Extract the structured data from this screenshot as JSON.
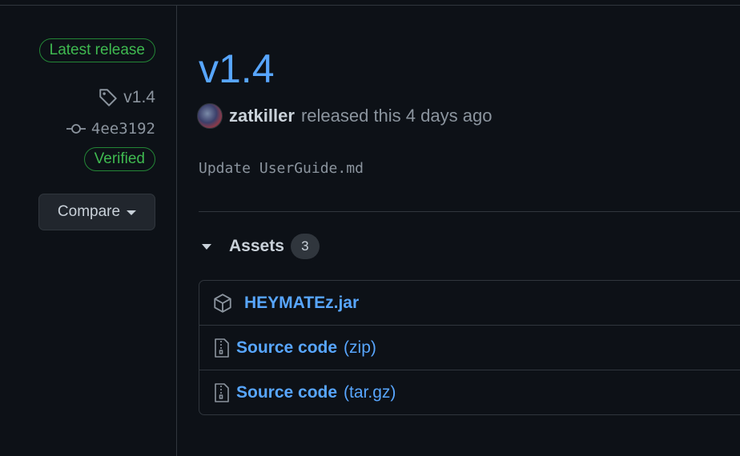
{
  "sidebar": {
    "latest_badge": "Latest release",
    "tag": "v1.4",
    "commit": "4ee3192",
    "verified_badge": "Verified",
    "compare_label": "Compare"
  },
  "release": {
    "title": "v1.4",
    "author": "zatkiller",
    "released_text": "released this 4 days ago",
    "body": "Update UserGuide.md"
  },
  "assets": {
    "label": "Assets",
    "count": "3",
    "items": [
      {
        "name": "HEYMATEz.jar",
        "suffix": "",
        "icon": "package-icon"
      },
      {
        "name": "Source code",
        "suffix": "(zip)",
        "icon": "file-zip-icon"
      },
      {
        "name": "Source code",
        "suffix": "(tar.gz)",
        "icon": "file-zip-icon"
      }
    ]
  },
  "colors": {
    "background": "#0d1117",
    "link": "#58a6ff",
    "success": "#3fb950",
    "border": "#30363d",
    "muted": "#8b949e"
  }
}
